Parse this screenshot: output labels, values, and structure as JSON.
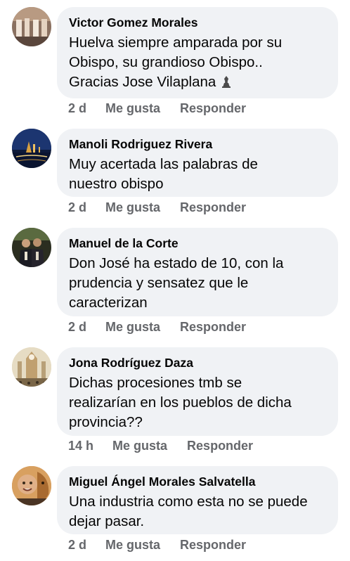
{
  "comments": [
    {
      "author": "Victor Gomez Morales",
      "lines": [
        "Huelva siempre amparada por su",
        "Obispo, su grandioso Obispo..",
        "Gracias Jose Vilaplana"
      ],
      "emoji_icon": "bishop-figure-emoji",
      "time": "2 d",
      "like": "Me gusta",
      "reply": "Responder"
    },
    {
      "author": "Manoli Rodriguez Rivera",
      "lines": [
        "Muy acertada las palabras de",
        "nuestro obispo"
      ],
      "time": "2 d",
      "like": "Me gusta",
      "reply": "Responder"
    },
    {
      "author": "Manuel de la Corte",
      "lines": [
        "Don José ha estado de 10, con la",
        "prudencia y sensatez que le",
        "caracterizan"
      ],
      "time": "2 d",
      "like": "Me gusta",
      "reply": "Responder"
    },
    {
      "author": "Jona Rodríguez Daza",
      "lines": [
        "Dichas procesiones tmb se",
        "realizarían en los pueblos de dicha",
        "provincia??"
      ],
      "time": "14 h",
      "like": "Me gusta",
      "reply": "Responder"
    },
    {
      "author": "Miguel Ángel Morales Salvatella",
      "lines": [
        "Una industria como esta no se puede",
        "dejar pasar."
      ],
      "time": "2 d",
      "like": "Me gusta",
      "reply": "Responder"
    }
  ],
  "colors": {
    "bubble": "#f0f2f5",
    "text": "#050505",
    "secondary": "#65676b"
  }
}
